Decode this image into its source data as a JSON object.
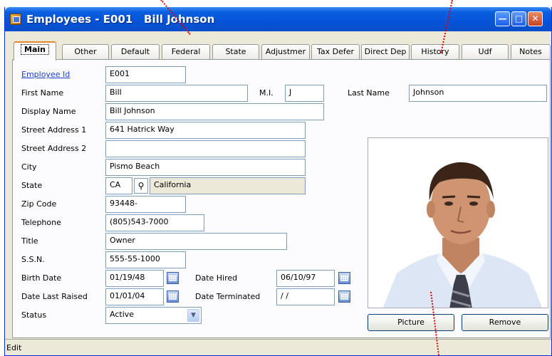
{
  "window": {
    "title": "Employees - E001   Bill Johnson"
  },
  "tabs": [
    {
      "label": "Main",
      "active": true
    },
    {
      "label": "Other"
    },
    {
      "label": "Default"
    },
    {
      "label": "Federal"
    },
    {
      "label": "State"
    },
    {
      "label": "Adjustmer"
    },
    {
      "label": "Tax Defer"
    },
    {
      "label": "Direct Dep"
    },
    {
      "label": "History"
    },
    {
      "label": "Udf"
    },
    {
      "label": "Notes"
    }
  ],
  "form": {
    "employee_id": {
      "label": "Employee Id",
      "value": "E001"
    },
    "first_name": {
      "label": "First Name",
      "value": "Bill"
    },
    "mi": {
      "label": "M.I.",
      "value": "J"
    },
    "last_name": {
      "label": "Last Name",
      "value": "Johnson"
    },
    "display_name": {
      "label": "Display Name",
      "value": "Bill Johnson"
    },
    "street1": {
      "label": "Street Address 1",
      "value": "641 Hatrick Way"
    },
    "street2": {
      "label": "Street Address 2",
      "value": ""
    },
    "city": {
      "label": "City",
      "value": "Pismo Beach"
    },
    "state": {
      "label": "State",
      "value": "CA",
      "name": "California"
    },
    "zip": {
      "label": "Zip Code",
      "value": "93448-"
    },
    "telephone": {
      "label": "Telephone",
      "value": "(805)543-7000"
    },
    "title": {
      "label": "Title",
      "value": "Owner"
    },
    "ssn": {
      "label": "S.S.N.",
      "value": "555-55-1000"
    },
    "birth_date": {
      "label": "Birth Date",
      "value": "01/19/48"
    },
    "date_hired": {
      "label": "Date Hired",
      "value": "06/10/97"
    },
    "date_last_raised": {
      "label": "Date Last Raised",
      "value": "01/01/04"
    },
    "date_terminated": {
      "label": "Date Terminated",
      "value": " / /"
    },
    "status": {
      "label": "Status",
      "value": "Active"
    }
  },
  "buttons": {
    "picture": "Picture",
    "remove": "Remove"
  },
  "statusbar": {
    "text": "Edit"
  },
  "icons": [
    "app-icon",
    "minimize-icon",
    "maximize-icon",
    "close-icon",
    "search-icon",
    "calendar-icon",
    "chevron-down-icon"
  ],
  "colors": {
    "titlebar": "#0553d8",
    "window_bg": "#ece9d8",
    "link": "#1a3ed0",
    "callout": "#dd0000"
  }
}
